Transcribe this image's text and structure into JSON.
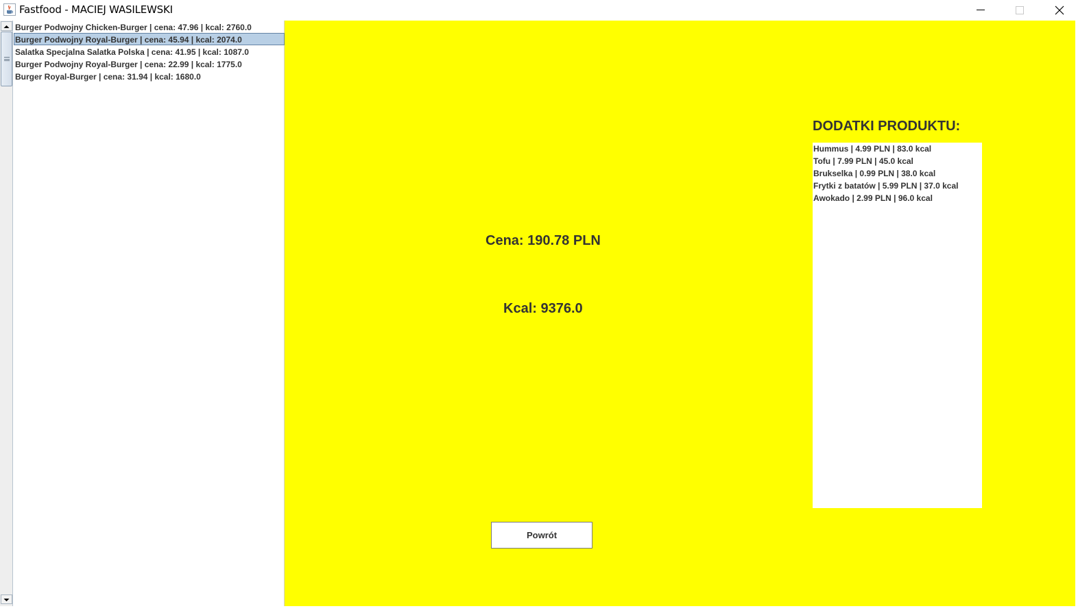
{
  "window": {
    "title": "Fastfood - MACIEJ WASILEWSKI",
    "icon": "java-cup-icon"
  },
  "products": {
    "items": [
      {
        "label": "Burger Podwojny Chicken-Burger | cena: 47.96 | kcal: 2760.0",
        "selected": false
      },
      {
        "label": "Burger Podwojny Royal-Burger | cena: 45.94 | kcal: 2074.0",
        "selected": true
      },
      {
        "label": "Salatka  Specjalna Salatka Polska | cena: 41.95 | kcal: 1087.0",
        "selected": false
      },
      {
        "label": "Burger Podwojny Royal-Burger | cena: 22.99 | kcal: 1775.0",
        "selected": false
      },
      {
        "label": "Burger Royal-Burger | cena: 31.94 | kcal: 1680.0",
        "selected": false
      }
    ]
  },
  "summary": {
    "cena": "Cena: 190.78 PLN",
    "kcal": "Kcal: 9376.0"
  },
  "addons": {
    "title": "DODATKI PRODUKTU:",
    "items": [
      "Hummus | 4.99 PLN | 83.0 kcal",
      "Tofu | 7.99 PLN | 45.0 kcal",
      "Brukselka | 0.99 PLN | 38.0 kcal",
      "Frytki z batatów | 5.99 PLN | 37.0 kcal",
      "Awokado | 2.99 PLN | 96.0 kcal"
    ]
  },
  "back_button": {
    "label": "Powrót"
  },
  "colors": {
    "panel_background": "#ffff00",
    "selection": "#b8cfe5",
    "text": "#333333"
  }
}
